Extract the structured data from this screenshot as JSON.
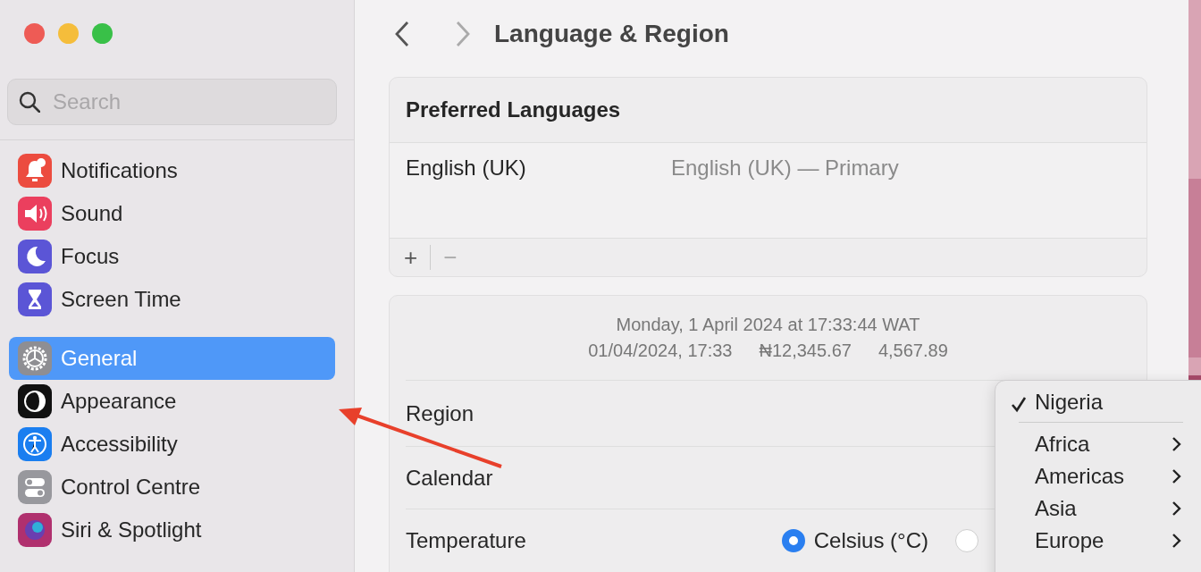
{
  "search": {
    "placeholder": "Search"
  },
  "sidebar": {
    "items": [
      {
        "label": "Notifications",
        "color": "#ec4c3f",
        "selected": false
      },
      {
        "label": "Sound",
        "color": "#eb3f5e",
        "selected": false
      },
      {
        "label": "Focus",
        "color": "#5b55d6",
        "selected": false
      },
      {
        "label": "Screen Time",
        "color": "#5b55d6",
        "selected": false
      },
      {
        "label": "General",
        "color": "#8e8e93",
        "selected": true
      },
      {
        "label": "Appearance",
        "color": "#111111",
        "selected": false
      },
      {
        "label": "Accessibility",
        "color": "#1a7ef0",
        "selected": false
      },
      {
        "label": "Control Centre",
        "color": "#98989d",
        "selected": false
      },
      {
        "label": "Siri & Spotlight",
        "color": "#b0306e",
        "selected": false
      }
    ]
  },
  "header": {
    "title": "Language & Region"
  },
  "preferred_languages": {
    "title": "Preferred Languages",
    "languages": [
      {
        "name": "English (UK)",
        "detail": "English (UK) — Primary"
      }
    ],
    "add": "+",
    "remove": "−"
  },
  "format_preview": {
    "line_1": "Monday, 1 April 2024 at 17:33:44 WAT",
    "line_2": [
      "01/04/2024, 17:33",
      "₦12,345.67",
      "4,567.89"
    ]
  },
  "settings": [
    {
      "kind": "menu",
      "label": "Region"
    },
    {
      "kind": "menu",
      "label": "Calendar"
    },
    {
      "kind": "radio",
      "label": "Temperature",
      "options": [
        {
          "label": "Celsius (°C)",
          "selected": true
        },
        {
          "selected": false
        }
      ]
    }
  ],
  "region_menu": {
    "items": [
      {
        "label": "Nigeria",
        "kind": "choice",
        "selected": true
      },
      {
        "label": "Africa",
        "kind": "submenu"
      },
      {
        "label": "Americas",
        "kind": "submenu"
      },
      {
        "label": "Asia",
        "kind": "submenu"
      },
      {
        "label": "Europe",
        "kind": "submenu"
      }
    ]
  }
}
